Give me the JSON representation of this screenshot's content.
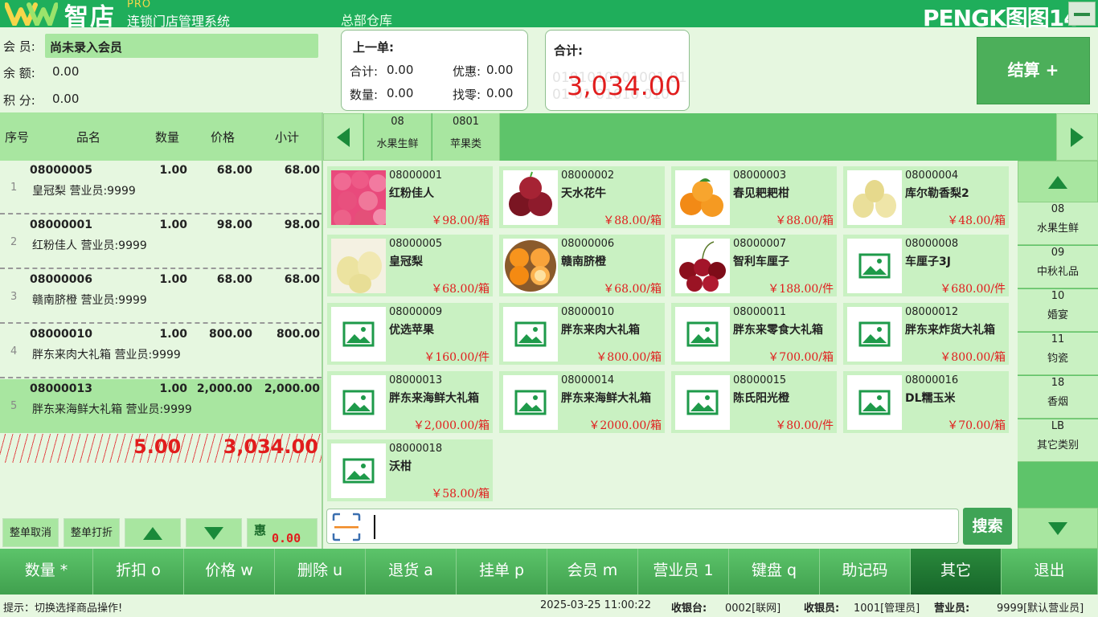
{
  "header": {
    "logo_zh": "智店",
    "logo_pro": "PRO",
    "logo_sub": "连锁门店管理系统",
    "warehouse": "总部仓库",
    "brand": "PENGK图图14"
  },
  "member": {
    "member_label": "会 员:",
    "member_value": "尚未录入会员",
    "balance_label": "余 额:",
    "balance_value": "0.00",
    "points_label": "积 分:",
    "points_value": "0.00"
  },
  "last_order": {
    "title": "上一单:",
    "total_label": "合计:",
    "total_value": "0.00",
    "discount_label": "优惠:",
    "discount_value": "0.00",
    "qty_label": "数量:",
    "qty_value": "0.00",
    "change_label": "找零:",
    "change_value": "0.00"
  },
  "total_panel": {
    "label": "合计:",
    "value": "3,034.00",
    "bg_digits_1": "0101010101001 01",
    "bg_digits_2": "01 01 01010 010"
  },
  "settle_label": "结算 +",
  "list": {
    "headers": [
      "序号",
      "品名",
      "数量",
      "价格",
      "小计"
    ],
    "rows": [
      {
        "idx": "1",
        "code": "08000005",
        "qty": "1.00",
        "price": "68.00",
        "subtotal": "68.00",
        "name": "皇冠梨 营业员:9999"
      },
      {
        "idx": "2",
        "code": "08000001",
        "qty": "1.00",
        "price": "98.00",
        "subtotal": "98.00",
        "name": "红粉佳人 营业员:9999"
      },
      {
        "idx": "3",
        "code": "08000006",
        "qty": "1.00",
        "price": "68.00",
        "subtotal": "68.00",
        "name": "赣南脐橙 营业员:9999"
      },
      {
        "idx": "4",
        "code": "08000010",
        "qty": "1.00",
        "price": "800.00",
        "subtotal": "800.00",
        "name": "胖东来肉大礼箱 营业员:9999"
      },
      {
        "idx": "5",
        "code": "08000013",
        "qty": "1.00",
        "price": "2,000.00",
        "subtotal": "2,000.00",
        "name": "胖东来海鲜大礼箱 营业员:9999"
      }
    ],
    "total_qty": "5.00",
    "total_amount": "3,034.00"
  },
  "left_buttons": {
    "cancel_all": "整单取消",
    "discount_all": "整单打折",
    "promo_label": "惠",
    "promo_value": "0.00"
  },
  "categories": [
    {
      "code": "08",
      "name": "水果生鲜"
    },
    {
      "code": "0801",
      "name": "苹果类"
    }
  ],
  "products": [
    {
      "code": "08000001",
      "name": "红粉佳人",
      "price": "￥98.00/箱",
      "image": "pink-apples"
    },
    {
      "code": "08000002",
      "name": "天水花牛",
      "price": "￥88.00/箱",
      "image": "red-apples"
    },
    {
      "code": "08000003",
      "name": "春见耙耙柑",
      "price": "￥88.00/箱",
      "image": "tangerines"
    },
    {
      "code": "08000004",
      "name": "库尔勒香梨2",
      "price": "￥48.00/箱",
      "image": "pears"
    },
    {
      "code": "08000005",
      "name": "皇冠梨",
      "price": "￥68.00/箱",
      "image": "crown-pears"
    },
    {
      "code": "08000006",
      "name": "赣南脐橙",
      "price": "￥68.00/箱",
      "image": "oranges"
    },
    {
      "code": "08000007",
      "name": "智利车厘子",
      "price": "￥188.00/件",
      "image": "cherries"
    },
    {
      "code": "08000008",
      "name": "车厘子3J",
      "price": "￥680.00/件",
      "image": "placeholder"
    },
    {
      "code": "08000009",
      "name": "优选苹果",
      "price": "￥160.00/件",
      "image": "placeholder"
    },
    {
      "code": "08000010",
      "name": "胖东来肉大礼箱",
      "price": "￥800.00/箱",
      "image": "placeholder"
    },
    {
      "code": "08000011",
      "name": "胖东来零食大礼箱",
      "price": "￥700.00/箱",
      "image": "placeholder"
    },
    {
      "code": "08000012",
      "name": "胖东来炸货大礼箱",
      "price": "￥800.00/箱",
      "image": "placeholder"
    },
    {
      "code": "08000013",
      "name": "胖东来海鲜大礼箱",
      "price": "￥2,000.00/箱",
      "image": "placeholder"
    },
    {
      "code": "08000014",
      "name": "胖东来海鲜大礼箱",
      "price": "￥2000.00/箱",
      "image": "placeholder"
    },
    {
      "code": "08000015",
      "name": "陈氏阳光橙",
      "price": "￥80.00/件",
      "image": "placeholder"
    },
    {
      "code": "08000016",
      "name": "DL糯玉米",
      "price": "￥70.00/箱",
      "image": "placeholder"
    },
    {
      "code": "08000018",
      "name": "沃柑",
      "price": "￥58.00/箱",
      "image": "placeholder"
    }
  ],
  "side_categories": [
    {
      "code": "08",
      "name": "水果生鲜"
    },
    {
      "code": "09",
      "name": "中秋礼品"
    },
    {
      "code": "10",
      "name": "婚宴"
    },
    {
      "code": "11",
      "name": "钧瓷"
    },
    {
      "code": "18",
      "name": "香烟"
    },
    {
      "code": "LB",
      "name": "其它类别"
    }
  ],
  "search": {
    "value": "",
    "button": "搜索"
  },
  "functions": [
    {
      "label": "数量 *",
      "active": false
    },
    {
      "label": "折扣 o",
      "active": false
    },
    {
      "label": "价格 w",
      "active": false
    },
    {
      "label": "删除 u",
      "active": false
    },
    {
      "label": "退货 a",
      "active": false
    },
    {
      "label": "挂单 p",
      "active": false
    },
    {
      "label": "会员 m",
      "active": false
    },
    {
      "label": "营业员 1",
      "active": false
    },
    {
      "label": "键盘 q",
      "active": false
    },
    {
      "label": "助记码",
      "active": false
    },
    {
      "label": "其它",
      "active": true
    },
    {
      "label": "退出",
      "active": false
    }
  ],
  "status": {
    "hint": "提示：切换选择商品操作!",
    "datetime": "2025-03-25 11:00:22",
    "register_label": "收银台:",
    "register_value": "0002[联网]",
    "cashier_label": "收银员:",
    "cashier_value": "1001[管理员]",
    "clerk_label": "营业员:",
    "clerk_value": "9999[默认营业员]"
  },
  "colors": {
    "accent": "#1fae5b",
    "price_red": "#e11d1d",
    "light_green": "#a8e6a0"
  }
}
